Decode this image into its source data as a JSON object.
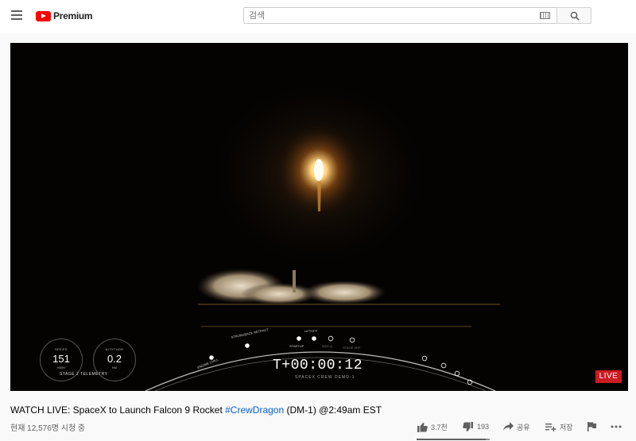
{
  "app": {
    "logo_text": "Premium",
    "icons": [
      "menu-icon",
      "youtube-logo-icon",
      "keyboard-icon",
      "search-icon",
      "thumbs-up-icon",
      "thumbs-down-icon",
      "share-icon",
      "playlist-add-icon",
      "flag-icon",
      "more-icon"
    ]
  },
  "search": {
    "placeholder": "검색",
    "value": ""
  },
  "player": {
    "live_label": "LIVE",
    "countdown": "T+00:00:12",
    "mission": "SPACEX CREW DEMO-1",
    "telemetry_label": "STAGE 2 TELEMETRY",
    "speed": {
      "label": "SPEED",
      "value": "151",
      "unit": "KM/H"
    },
    "altitude": {
      "label": "ALTITUDE",
      "value": "0.2",
      "unit": "KM"
    },
    "timeline": [
      "ENGINE CHILL",
      "STRONGBACK RETRACT",
      "STARTUP",
      "LIFTOFF",
      "MAX-Q",
      "STAGE SEP"
    ]
  },
  "video": {
    "title_pre": "WATCH LIVE: SpaceX to Launch Falcon 9 Rocket ",
    "hashtag": "#CrewDragon",
    "title_post": " (DM-1) @2:49am EST",
    "views": "현재 12,576명 시청 중"
  },
  "actions": {
    "like_count": "3.7천",
    "dislike_count": "193",
    "share_label": "공유",
    "save_label": "저장",
    "like_ratio": 0.95
  },
  "colors": {
    "brand": "#ff0000",
    "live": "#cc1c22",
    "link": "#065fd4"
  }
}
